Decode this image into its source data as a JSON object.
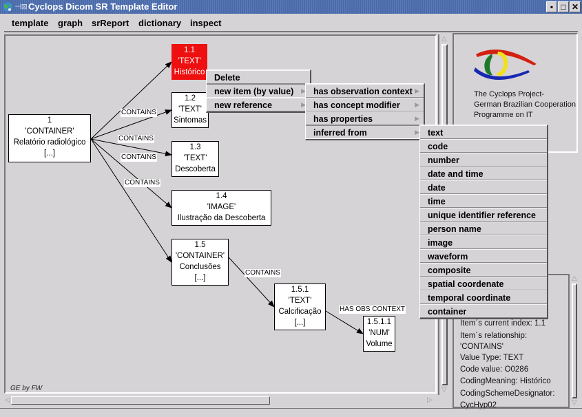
{
  "window": {
    "title": "Cyclops Dicom SR Template Editor",
    "pin_icon": "⊣⊠",
    "controls": {
      "minimize": "▪",
      "maximize": "□",
      "close": "✕"
    }
  },
  "menubar": {
    "items": [
      "template",
      "graph",
      "srReport",
      "dictionary",
      "inspect"
    ]
  },
  "graph": {
    "nodes": [
      {
        "id": "1",
        "lines": [
          "1",
          "'CONTAINER'",
          "Relatório radiológico",
          "[...]"
        ],
        "selected": false
      },
      {
        "id": "1.1",
        "lines": [
          "1.1",
          "'TEXT'",
          "Histórico"
        ],
        "selected": true
      },
      {
        "id": "1.2",
        "lines": [
          "1.2",
          "'TEXT'",
          "Sintomas"
        ],
        "selected": false
      },
      {
        "id": "1.3",
        "lines": [
          "1.3",
          "'TEXT'",
          "Descoberta"
        ],
        "selected": false
      },
      {
        "id": "1.4",
        "lines": [
          "1.4",
          "'IMAGE'",
          "Ilustração da Descoberta"
        ],
        "selected": false
      },
      {
        "id": "1.5",
        "lines": [
          "1.5",
          "'CONTAINER'",
          "Conclusões",
          "[...]"
        ],
        "selected": false
      },
      {
        "id": "1.5.1",
        "lines": [
          "1.5.1",
          "'TEXT'",
          "Calcificação",
          "[...]"
        ],
        "selected": false
      },
      {
        "id": "1.5.1.1",
        "lines": [
          "1.5.1.1",
          "'NUM'",
          "Volume"
        ],
        "selected": false
      }
    ],
    "edges": [
      {
        "from": "1",
        "to": "1.1",
        "label": "CONTAINS"
      },
      {
        "from": "1",
        "to": "1.2",
        "label": "CONTAINS"
      },
      {
        "from": "1",
        "to": "1.3",
        "label": "CONTAINS"
      },
      {
        "from": "1",
        "to": "1.4",
        "label": "CONTAINS"
      },
      {
        "from": "1",
        "to": "1.5",
        "label": "CONTAINS"
      },
      {
        "from": "1.5",
        "to": "1.5.1",
        "label": "CONTAINS"
      },
      {
        "from": "1.5.1",
        "to": "1.5.1.1",
        "label": "HAS OBS CONTEXT"
      }
    ],
    "overlapping_label": "CONTAINS",
    "credit": "GE by FW"
  },
  "context_menu": {
    "items": [
      {
        "label": "Delete",
        "submenu": false
      },
      {
        "label": "new item (by value)",
        "submenu": true
      },
      {
        "label": "new reference",
        "submenu": true
      }
    ],
    "relationship_menu": [
      {
        "label": "has observation context",
        "submenu": true
      },
      {
        "label": "has concept modifier",
        "submenu": true
      },
      {
        "label": "has properties",
        "submenu": true
      },
      {
        "label": "inferred from",
        "submenu": true
      }
    ],
    "value_type_menu": [
      "text",
      "code",
      "number",
      "date and time",
      "date",
      "time",
      "unique identifier reference",
      "person name",
      "image",
      "waveform",
      "composite",
      "spatial coordenate",
      "temporal coordinate",
      "container"
    ]
  },
  "logo": {
    "caption": [
      "The Cyclops Project-",
      "German Brazilian Cooperation",
      "Programme on IT"
    ],
    "colors": {
      "red": "#d42010",
      "green": "#1e7a2a",
      "yellow": "#f0e020",
      "blue": "#1828b0"
    }
  },
  "info": {
    "lines": [
      "Item´s current index: 1.1",
      "Item´s relationship:",
      "'CONTAINS'",
      "Value Type: TEXT",
      "Code value: O0286",
      "CodingMeaning: Histórico",
      "CodingSchemeDesignator:",
      "CycHyp02"
    ]
  },
  "colors": {
    "selected_node": "#ee1010",
    "titlebar": "#5070b0",
    "background": "#d6d3d6"
  }
}
